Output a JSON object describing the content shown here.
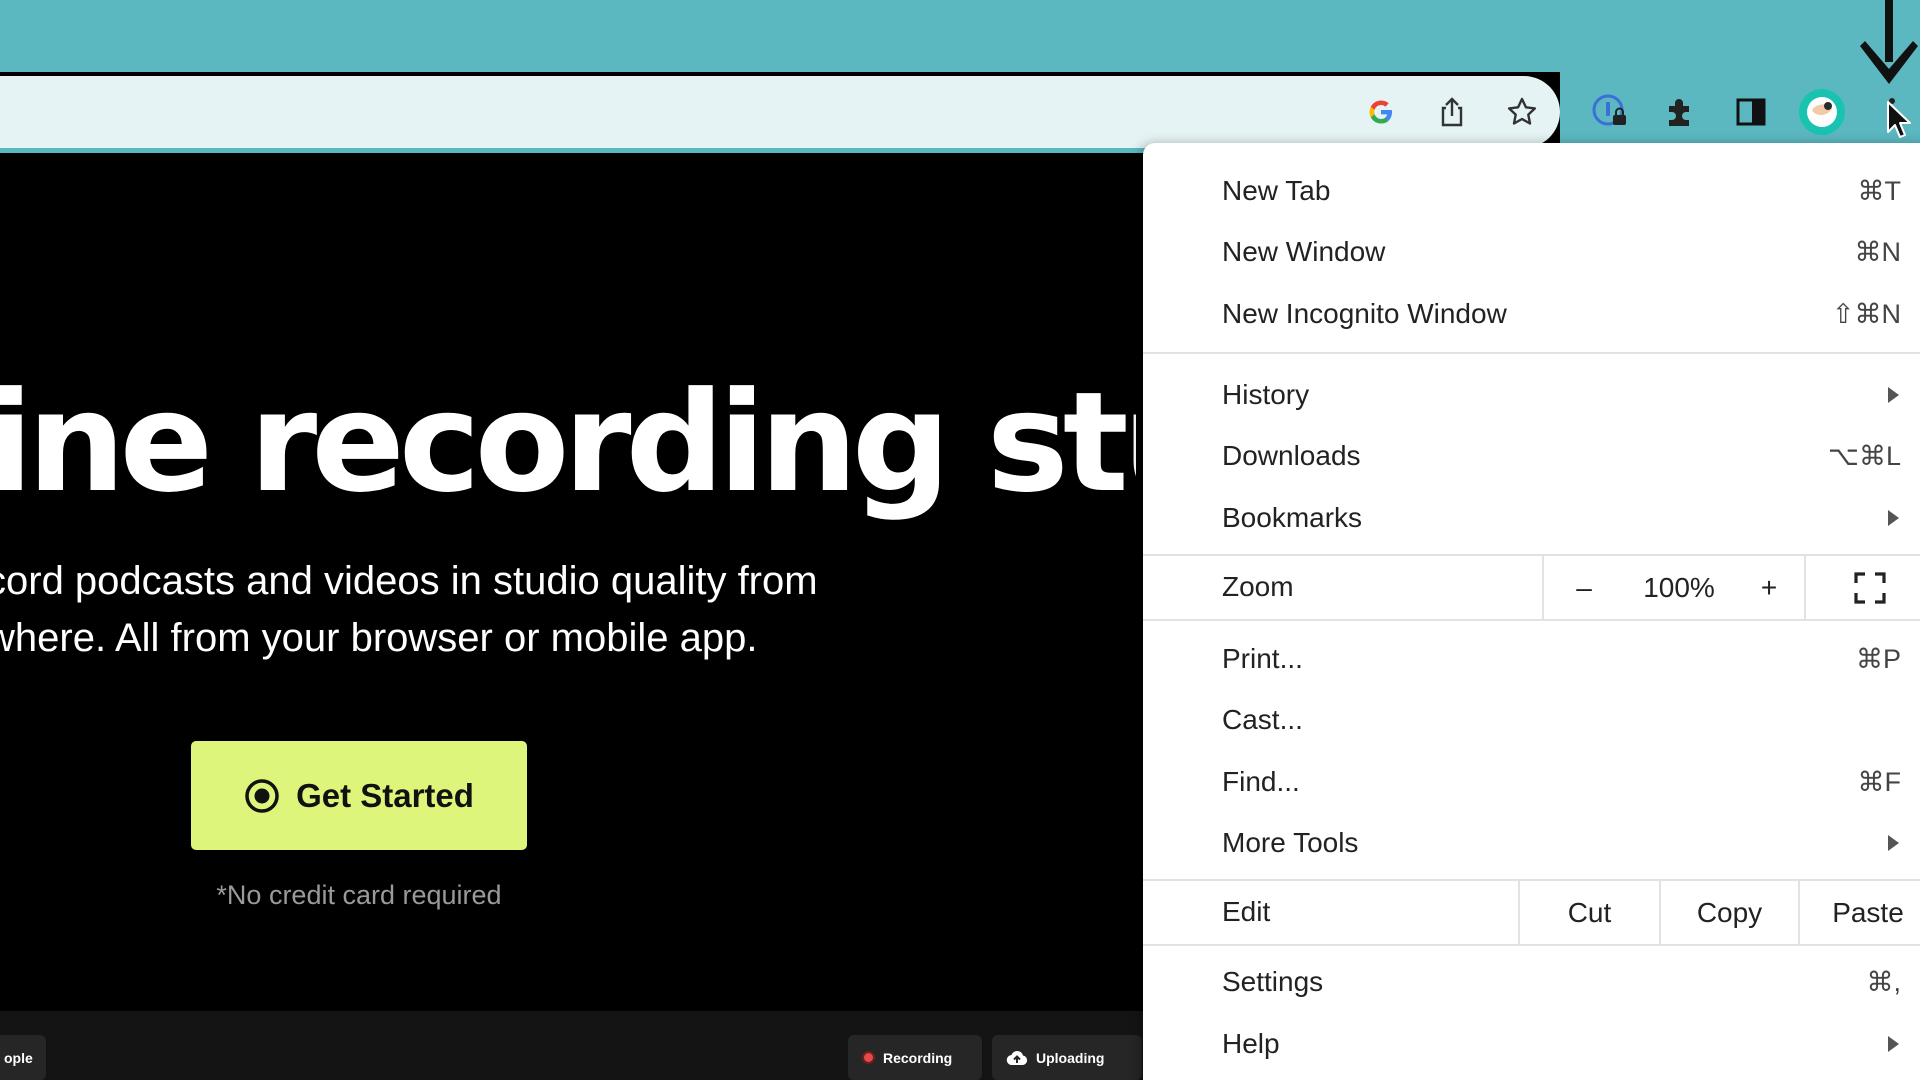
{
  "toolbar": {
    "icons": [
      "google-icon",
      "share-icon",
      "bookmark-star-icon",
      "password-manager-icon",
      "extensions-icon",
      "side-panel-icon",
      "profile-avatar",
      "kebab-menu-icon"
    ]
  },
  "page": {
    "hero_title": "ine recording studi",
    "hero_subtitle_line1": "cord podcasts and videos in studio quality from",
    "hero_subtitle_line2": "where. All from your browser or mobile app.",
    "cta_label": "Get Started",
    "cta_note": "*No credit card required",
    "chips": {
      "people": "ople",
      "recording": "Recording",
      "uploading": "Uploading"
    },
    "accent_color": "#dcf57a"
  },
  "menu": {
    "new_tab": {
      "label": "New Tab",
      "shortcut": "⌘T"
    },
    "new_window": {
      "label": "New Window",
      "shortcut": "⌘N"
    },
    "new_incognito": {
      "label": "New Incognito Window",
      "shortcut": "⇧⌘N"
    },
    "history": {
      "label": "History"
    },
    "downloads": {
      "label": "Downloads",
      "shortcut": "⌥⌘L"
    },
    "bookmarks": {
      "label": "Bookmarks"
    },
    "zoom": {
      "label": "Zoom",
      "minus": "–",
      "value": "100%",
      "plus": "+"
    },
    "print": {
      "label": "Print...",
      "shortcut": "⌘P"
    },
    "cast": {
      "label": "Cast..."
    },
    "find": {
      "label": "Find...",
      "shortcut": "⌘F"
    },
    "more_tools": {
      "label": "More Tools"
    },
    "edit": {
      "label": "Edit",
      "cut": "Cut",
      "copy": "Copy",
      "paste": "Paste"
    },
    "settings": {
      "label": "Settings",
      "shortcut": "⌘,"
    },
    "help": {
      "label": "Help"
    }
  }
}
